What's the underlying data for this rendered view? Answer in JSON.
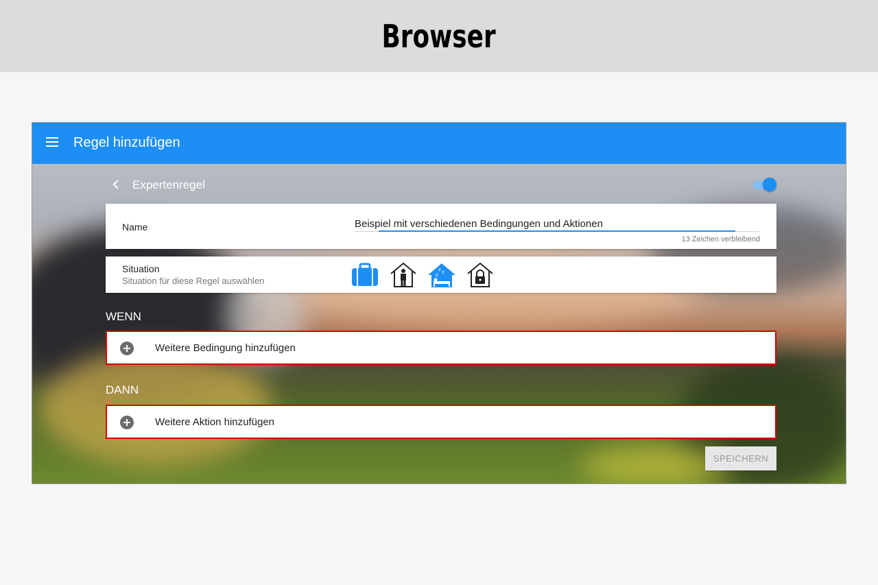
{
  "banner": {
    "title": "Browser"
  },
  "appbar": {
    "title": "Regel hinzufügen",
    "menu_icon": "hamburger-menu-icon"
  },
  "subheader": {
    "title": "Expertenregel",
    "toggle_on": true,
    "back_icon": "chevron-left-icon"
  },
  "name_card": {
    "label": "Name",
    "value": "Beispiel mit verschiedenen Bedingungen und Aktionen",
    "counter": "13 Zeichen verbleibend"
  },
  "situation_card": {
    "label": "Situation",
    "sublabel": "Situation für diese Regel auswählen",
    "icons": [
      {
        "name": "suitcase-icon",
        "selected": true
      },
      {
        "name": "person-home-icon",
        "selected": false
      },
      {
        "name": "sleep-home-icon",
        "selected": true
      },
      {
        "name": "lock-home-icon",
        "selected": false
      }
    ]
  },
  "wenn": {
    "heading": "WENN",
    "add_label": "Weitere Bedingung hinzufügen"
  },
  "dann": {
    "heading": "DANN",
    "add_label": "Weitere Aktion hinzufügen"
  },
  "save_label": "SPEICHERN",
  "colors": {
    "primary": "#1d8ff4",
    "highlight_border": "#e00000",
    "save_disabled_bg": "#e6e6e6"
  }
}
